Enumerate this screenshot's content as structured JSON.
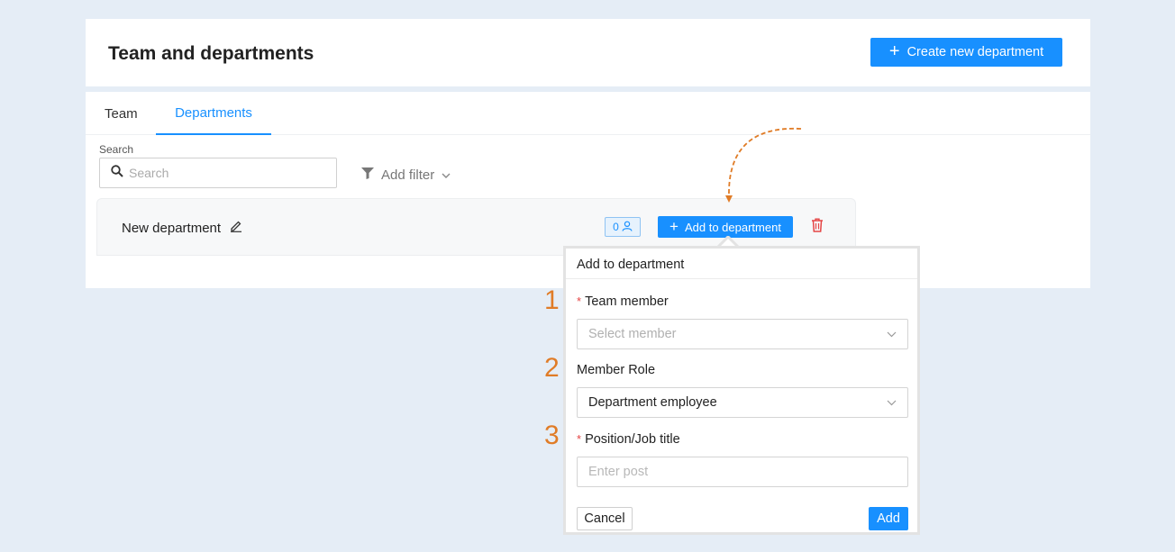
{
  "header": {
    "title": "Team and departments",
    "create_label": "Create new department"
  },
  "tabs": [
    {
      "label": "Team",
      "active": false
    },
    {
      "label": "Departments",
      "active": true
    }
  ],
  "search": {
    "label": "Search",
    "placeholder": "Search",
    "value": ""
  },
  "filter": {
    "label": "Add filter"
  },
  "department": {
    "name": "New department",
    "member_count": "0",
    "add_label": "Add to department"
  },
  "popup": {
    "title": "Add to department",
    "fields": [
      {
        "label": "Team member",
        "required": true,
        "placeholder": "Select member",
        "value": ""
      },
      {
        "label": "Member Role",
        "required": false,
        "placeholder": "",
        "value": "Department employee"
      },
      {
        "label": "Position/Job title",
        "required": true,
        "placeholder": "Enter post",
        "value": ""
      }
    ],
    "required_mark": "*",
    "cancel_label": "Cancel",
    "submit_label": "Add"
  },
  "annotations": {
    "steps": [
      "1",
      "2",
      "3"
    ],
    "color": "#e07c27"
  },
  "colors": {
    "accent": "#1890ff",
    "danger": "#e54545",
    "background": "#e5edf6"
  },
  "icons": {
    "plus": "plus-icon",
    "search": "search-icon",
    "filter": "filter-icon",
    "chevron": "chevron-down-icon",
    "edit": "edit-pencil-icon",
    "user": "user-icon",
    "delete": "trash-icon"
  }
}
